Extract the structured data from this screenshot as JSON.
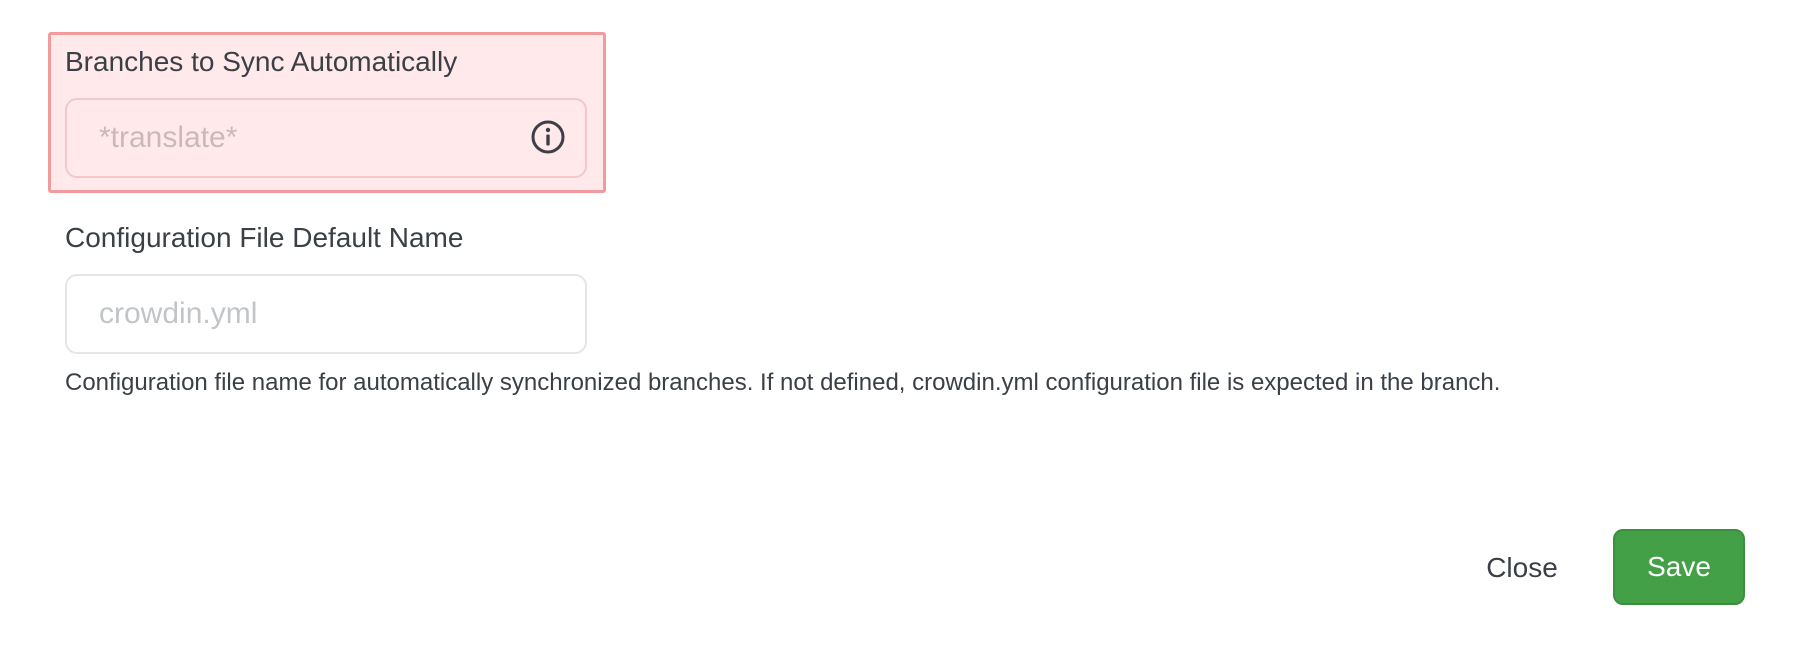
{
  "branches_field": {
    "label": "Branches to Sync Automatically",
    "placeholder": "*translate*",
    "value": "",
    "info_icon": "info-circle-icon",
    "highlight_fill": "#ffe9eb",
    "highlight_border": "#f29a9c"
  },
  "config_field": {
    "label": "Configuration File Default Name",
    "placeholder": "crowdin.yml",
    "value": "",
    "help_text": "Configuration file name for automatically synchronized branches. If not defined, crowdin.yml configuration file is expected in the branch."
  },
  "footer": {
    "close_label": "Close",
    "save_label": "Save",
    "save_color": "#43a047"
  }
}
